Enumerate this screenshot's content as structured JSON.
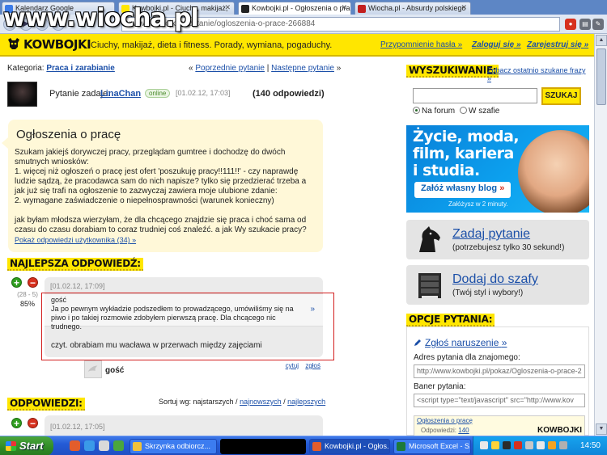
{
  "browser": {
    "tabs": [
      {
        "title": "Kalendarz Google",
        "active": false
      },
      {
        "title": "Kowbojki.pl - Ciuchy, makijaż,",
        "active": false
      },
      {
        "title": "Kowbojki.pl - Ogłoszenia o pra",
        "active": true
      },
      {
        "title": "Wiocha.pl - Absurdy polskiego",
        "active": false
      }
    ],
    "url": "www.kowbojki.pl/pytanie/ogloszenia-o-prace-266884",
    "watermark": "www.wiocha.pl"
  },
  "site": {
    "logo": "KOWBOJKI",
    "tagline": "Ciuchy, makijaż, dieta i fitness. Porady, wymiana, pogaduchy.",
    "links": {
      "reminder": "Przypomnienie hasła »",
      "login": "Zaloguj się »",
      "register": "Zarejestruj się »"
    }
  },
  "breadcrumb": {
    "label": "Kategoria:",
    "category": "Praca i zarabianie",
    "prev": "Poprzednie pytanie",
    "next": "Następne pytanie",
    "prefix": "« ",
    "separator": " | ",
    "suffix": " »"
  },
  "question": {
    "asker_label": "Pytanie zadaje:",
    "asker": "LinaChan",
    "status": "online",
    "date": "[01.02.12, 17:03]",
    "answers_count": "(140 odpowiedzi)",
    "title": "Ogłoszenia o pracę",
    "body": "Szukam jakiejś dorywczej pracy, przeglądam gumtree i dochodzę do dwóch smutnych wniosków:\n1. więcej niż ogłoszeń o pracę jest ofert 'poszukuję pracy!!111!!' - czy naprawdę ludzie sądzą, że pracodawca sam do nich napisze? tylko się przedzierać trzeba a jak już się trafi na ogłoszenie to zazwyczaj zawiera moje ulubione zdanie:\n2. wymagane zaświadczenie o niepełnosprawności (warunek konieczny)\n\njak byłam młodsza wierzyłam, że dla chcącego znajdzie się praca i choć sama od czasu do czasu dorabiam to coraz trudniej coś znaleźć. a jak Wy szukacie pracy?",
    "more_link": "Pokaż odpowiedzi użytkownika (34) »"
  },
  "best_answer": {
    "heading": "NAJLEPSZA ODPOWIEDŹ:",
    "score": "(28 - 5)",
    "percent": "85%",
    "date": "[01.02.12, 17:09]",
    "quote_author": "gość",
    "quote": "Ja po pewnym wykładzie podszedłem to prowadzącego, umówiliśmy się na piwo i po takiej rozmowie zdobyłem pierwszą pracę. Dla chcącego nic trudnego.",
    "quote_arrow": "»",
    "text": "czyt. obrabiam mu wacława w przerwach między zajęciami",
    "author": "gość",
    "cite": "cytuj",
    "report": "zgłoś"
  },
  "answers": {
    "heading": "ODPOWIEDZI:",
    "sort_label": "Sortuj wg: najstarszych /",
    "sort_newest": "najnowszych",
    "sort_sep": "/",
    "sort_best": "najlepszych",
    "first_date": "[01.02.12, 17:05]"
  },
  "search": {
    "heading": "WYSZUKIWANIE:",
    "recent_link": "Zobacz ostatnio szukane frazy »",
    "button": "SZUKAJ",
    "option_forum": "Na forum",
    "option_wardrobe": "W szafie"
  },
  "banner": {
    "text": "Życie, moda,\nfilm, kariera\ni studia.",
    "cta": "Załóż własny blog",
    "cta_arrow": "»",
    "sub": "Załóżysz w 2 minuty."
  },
  "ask_box": {
    "title": "Zadaj pytanie",
    "subtitle": "(potrzebujesz tylko 30 sekund!)"
  },
  "wardrobe_box": {
    "title": "Dodaj do szafy",
    "subtitle": "(Twój styl i wybory!)"
  },
  "options": {
    "heading": "OPCJE PYTANIA:",
    "report": "Zgłoś naruszenie",
    "report_arrow": "»",
    "friend_label": "Adres pytania dla znajomego:",
    "friend_url": "http://www.kowbojki.pl/pokaz/Ogloszenia-o-prace-2",
    "banner_label": "Baner pytania:",
    "banner_code": "<script type=\"text/javascript\" src=\"http://www.kov",
    "mini_title": "Ogłoszenia o pracę",
    "mini_answers_label": "Odpowiedzi:",
    "mini_answers": "140",
    "mini_logo": "KOWBOJKI"
  },
  "taskbar": {
    "start": "Start",
    "tasks": [
      {
        "label": "Skrzynka odbiorcz...",
        "dark": false,
        "active": false
      },
      {
        "label": "",
        "dark": true,
        "active": false
      },
      {
        "label": "Kowbojki.pl - Ogłos...",
        "dark": false,
        "active": true
      },
      {
        "label": "Microsoft Excel - S...",
        "dark": false,
        "active": false
      }
    ],
    "time": "14:50"
  }
}
